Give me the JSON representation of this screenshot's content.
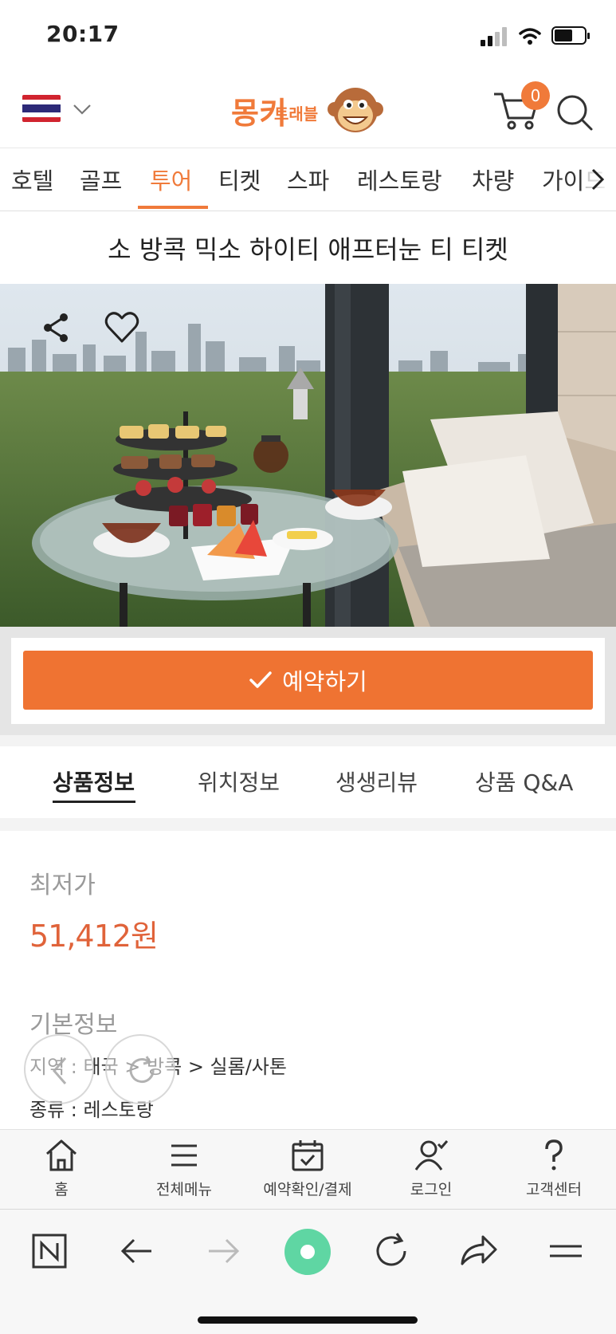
{
  "status_bar": {
    "time": "20:17"
  },
  "header": {
    "logo_text": "몽키",
    "logo_sub": "트래블",
    "cart_count": "0"
  },
  "category_nav": {
    "items": [
      "호텔",
      "골프",
      "투어",
      "티켓",
      "스파",
      "레스토랑",
      "차량",
      "가이드"
    ],
    "active": "투어"
  },
  "product": {
    "title": "소 방콕 믹소 하이티 애프터눈 티 티켓"
  },
  "booking": {
    "button_label": "예약하기"
  },
  "tabs": {
    "items": [
      "상품정보",
      "위치정보",
      "생생리뷰",
      "상품 Q&A"
    ],
    "active": "상품정보"
  },
  "info": {
    "lowest_price_label": "최저가",
    "lowest_price": "51,412원",
    "basic_info_label": "기본정보",
    "region": "지역 : 태국 > 방콕 > 실롬/사톤",
    "kind": "종류 : 레스토랑"
  },
  "bottom_nav": {
    "items": [
      {
        "label": "홈",
        "icon": "home-icon"
      },
      {
        "label": "전체메뉴",
        "icon": "menu-icon"
      },
      {
        "label": "예약확인/결제",
        "icon": "calendar-check-icon"
      },
      {
        "label": "로그인",
        "icon": "user-check-icon"
      },
      {
        "label": "고객센터",
        "icon": "question-icon"
      }
    ]
  },
  "colors": {
    "accent": "#ef7332",
    "price": "#e0633a",
    "browser_green": "#5fd6a3"
  }
}
